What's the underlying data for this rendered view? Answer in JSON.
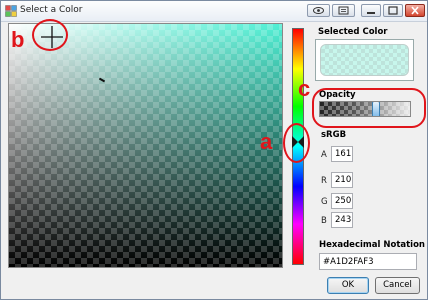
{
  "window": {
    "title": "Select a Color",
    "buttons": [
      "eye-icon",
      "screenshot-icon",
      "minimize-icon",
      "maximize-icon",
      "close-icon"
    ]
  },
  "picker": {
    "base_hue_color": "#4ef0d4",
    "selected_color": "#A1D2FAF3"
  },
  "panel": {
    "selected_color_label": "Selected Color",
    "opacity_label": "Opacity",
    "opacity_fraction": 0.63,
    "srgb_label": "sRGB",
    "fields": [
      {
        "label": "A",
        "value": "161"
      },
      {
        "label": "R",
        "value": "210"
      },
      {
        "label": "G",
        "value": "250"
      },
      {
        "label": "B",
        "value": "243"
      }
    ],
    "hex_label": "Hexadecimal Notation",
    "hex_value": "#A1D2FAF3"
  },
  "buttons": {
    "ok": "OK",
    "cancel": "Cancel"
  },
  "annotations": {
    "a": "a",
    "b": "b",
    "c": "c",
    "color": "#e0151b"
  }
}
